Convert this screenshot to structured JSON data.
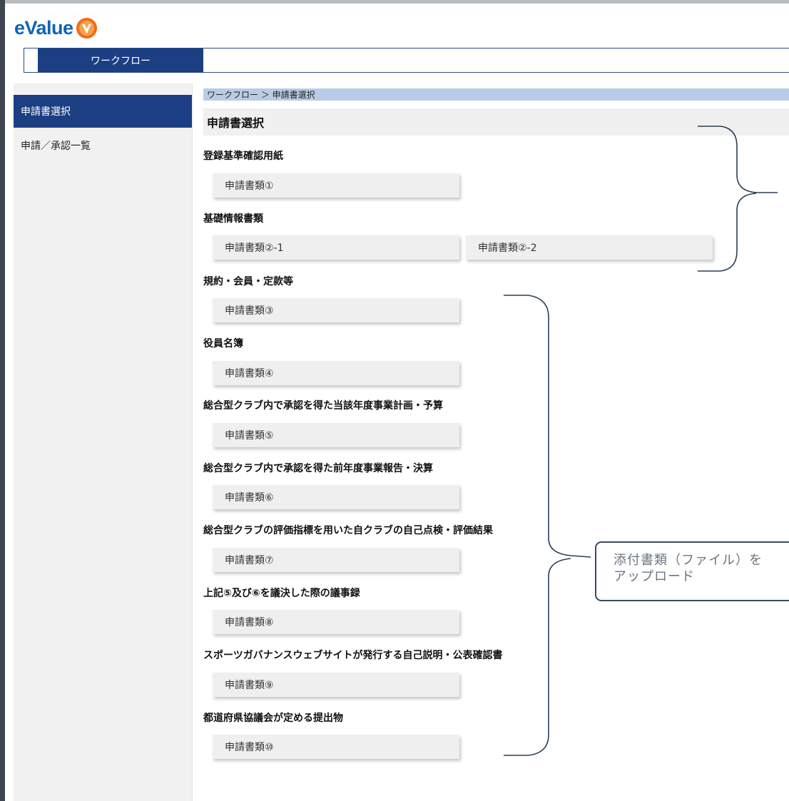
{
  "logo": {
    "text": "eValue"
  },
  "nav": {
    "tab_label": "ワークフロー"
  },
  "sidebar": {
    "items": [
      {
        "label": "申請書選択"
      },
      {
        "label": "申請／承認一覧"
      }
    ]
  },
  "breadcrumb": "ワークフロー ＞ 申請書選択",
  "page_title": "申請書選択",
  "sections": [
    {
      "heading": "登録基準確認用紙",
      "buttons": [
        "申請書類①"
      ]
    },
    {
      "heading": "基礎情報書類",
      "buttons": [
        "申請書類②-1",
        "申請書類②-2"
      ]
    },
    {
      "heading": "規約・会員・定款等",
      "buttons": [
        "申請書類③"
      ]
    },
    {
      "heading": "役員名簿",
      "buttons": [
        "申請書類④"
      ]
    },
    {
      "heading": "総合型クラブ内で承認を得た当該年度事業計画・予算",
      "buttons": [
        "申請書類⑤"
      ]
    },
    {
      "heading": "総合型クラブ内で承認を得た前年度事業報告・決算",
      "buttons": [
        "申請書類⑥"
      ]
    },
    {
      "heading": "総合型クラブの評価指標を用いた自クラブの自己点検・評価結果",
      "buttons": [
        "申請書類⑦"
      ]
    },
    {
      "heading": "上記⑤及び⑥を議決した際の議事録",
      "buttons": [
        "申請書類⑧"
      ]
    },
    {
      "heading": "スポーツガバナンスウェブサイトが発行する自己説明・公表確認書",
      "buttons": [
        "申請書類⑨"
      ]
    },
    {
      "heading": "都道府県協議会が定める提出物",
      "buttons": [
        "申請書類⑩"
      ]
    }
  ],
  "annotation": {
    "callout_text": "添付書類（ファイル）を\nアップロード"
  },
  "colors": {
    "primary": "#1b3f82",
    "breadcrumb_bg": "#b8cce6",
    "logo_blue": "#0f64b6",
    "logo_orange": "#f26a1b"
  }
}
